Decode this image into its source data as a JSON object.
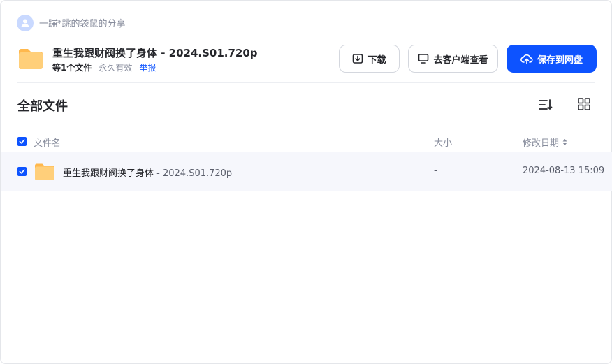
{
  "sharer": {
    "name_text": "一蹦*跳的袋鼠的分享",
    "icon": "user-avatar-icon"
  },
  "share": {
    "title": "重生我跟财阀换了身体 - 2024.S01.720p",
    "file_count": "等1个文件",
    "validity": "永久有效",
    "report_link": "举报",
    "folder_icon": "folder-icon"
  },
  "actions": {
    "download_label": "下载",
    "client_view_label": "去客户端查看",
    "save_label": "保存到网盘"
  },
  "section": {
    "title": "全部文件"
  },
  "table": {
    "columns": {
      "name": "文件名",
      "size": "大小",
      "date": "修改日期"
    },
    "rows": [
      {
        "name": "重生我跟财阀换了身体",
        "suffix": " - 2024.S01.720p",
        "size": "-",
        "date": "2024-08-13 15:09",
        "selected": true
      }
    ]
  },
  "colors": {
    "accent": "#0d53ff",
    "folder": "#ffc76e",
    "row_highlight": "#f6f7fc"
  }
}
